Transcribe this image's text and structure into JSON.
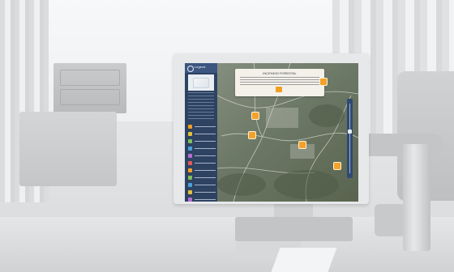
{
  "scene": {
    "subject": "person-at-desk",
    "viewpoint": "over-the-shoulder"
  },
  "screen_app": {
    "sidebar": {
      "header_label": "Legend",
      "legend_colors": [
        "#f0a024",
        "#e2c23a",
        "#7fbf5a",
        "#4aa2d8",
        "#b76fd1",
        "#e35a5a",
        "#f0a024",
        "#7fbf5a",
        "#4aa2d8",
        "#e2c23a",
        "#b76fd1",
        "#e35a5a"
      ]
    },
    "popup": {
      "title": "INCENDIO FORESTAL"
    },
    "marker_color": "#f3a12a"
  }
}
